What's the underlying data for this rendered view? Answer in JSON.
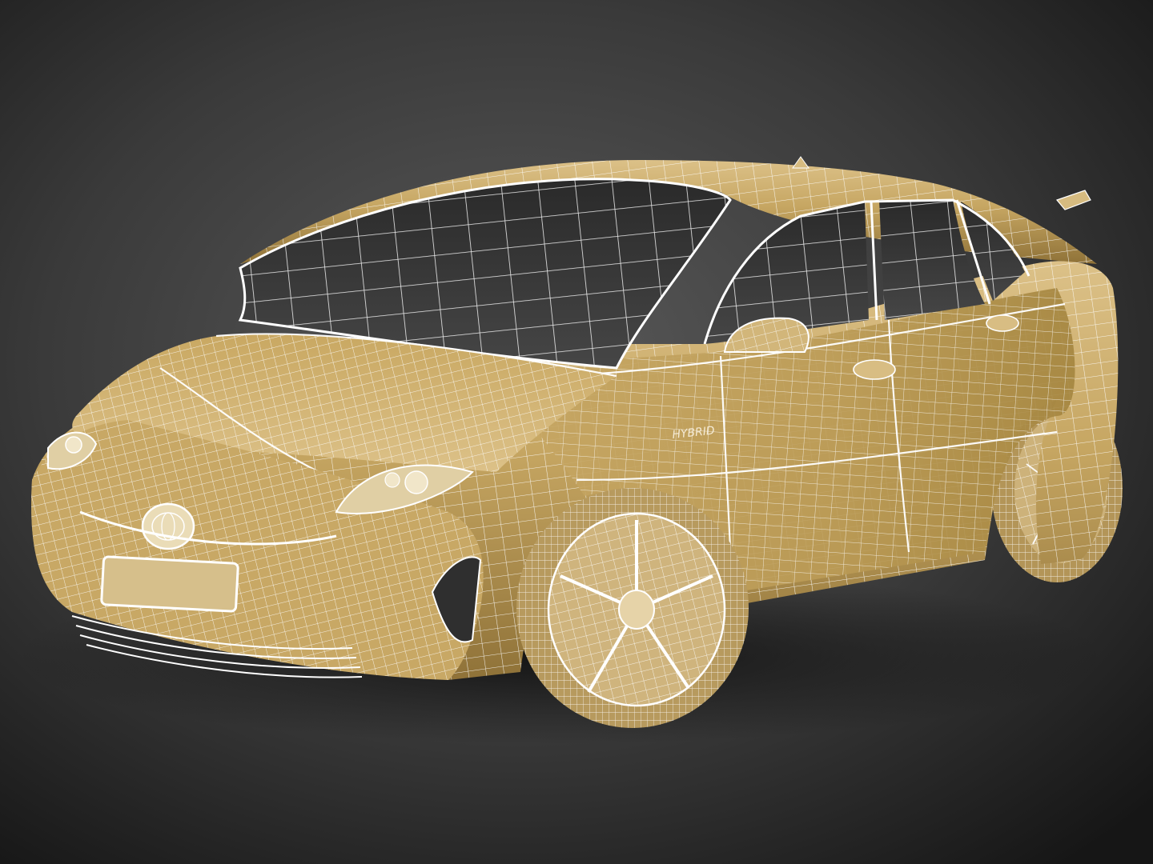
{
  "scene": {
    "subject": "car-wireframe-render",
    "badge_text": "HYBRID",
    "colors": {
      "background_center": "#5a5a5a",
      "background_mid": "#3a3a3a",
      "background_edge": "#161616",
      "body_light": "#d8bc7c",
      "body_mid": "#c4a35f",
      "body_dark": "#8f7238",
      "body_shadow": "#6a5229",
      "glass": "#3e3e3e",
      "glass_dark": "#262626",
      "wire": "#ffffff",
      "tire": "#c9ad72",
      "ground_shadow": "#0c0c0c"
    }
  }
}
